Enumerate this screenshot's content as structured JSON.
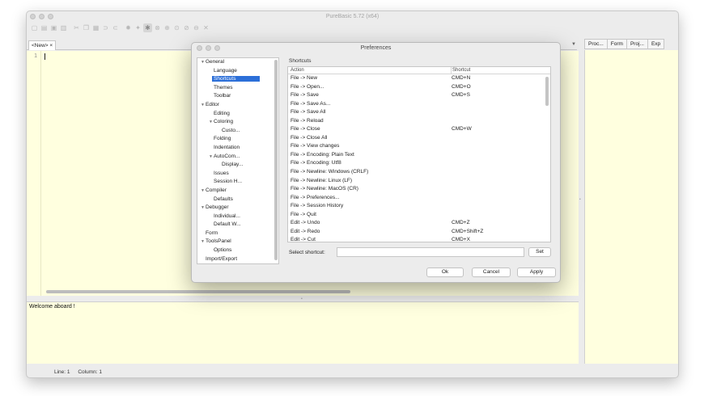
{
  "window": {
    "title": "PureBasic 5.72 (x64)"
  },
  "toolbar": {
    "icons": [
      "new-file-icon",
      "open-file-icon",
      "save-icon",
      "save-all-icon",
      "cut-icon",
      "copy-icon",
      "paste-icon",
      "comment-icon",
      "uncomment-icon",
      "compile-icon",
      "run-icon",
      "debugger-icon",
      "stop-icon",
      "step-icon",
      "step-over-icon",
      "step-out-icon",
      "kill-icon",
      "close-icon"
    ]
  },
  "editor": {
    "tab_label": "<New>",
    "tab_close": "×",
    "line_number": "1"
  },
  "output": {
    "text": "Welcome aboard !"
  },
  "status": {
    "line": "Line: 1",
    "column": "Column: 1"
  },
  "tool_tabs": [
    "Proc...",
    "Form",
    "Proj...",
    "Exp"
  ],
  "dialog": {
    "title": "Preferences",
    "tree": [
      {
        "label": "General",
        "level": 0,
        "expanded": true
      },
      {
        "label": "Language",
        "level": 1
      },
      {
        "label": "Shortcuts",
        "level": 1,
        "selected": true
      },
      {
        "label": "Themes",
        "level": 1
      },
      {
        "label": "Toolbar",
        "level": 1
      },
      {
        "label": "Editor",
        "level": 0,
        "expanded": true
      },
      {
        "label": "Editing",
        "level": 1
      },
      {
        "label": "Coloring",
        "level": 1,
        "expanded": true
      },
      {
        "label": "Custo...",
        "level": 2
      },
      {
        "label": "Folding",
        "level": 1
      },
      {
        "label": "Indentation",
        "level": 1
      },
      {
        "label": "AutoCom...",
        "level": 1,
        "expanded": true
      },
      {
        "label": "Display...",
        "level": 2
      },
      {
        "label": "Issues",
        "level": 1
      },
      {
        "label": "Session H...",
        "level": 1
      },
      {
        "label": "Compiler",
        "level": 0,
        "expanded": true
      },
      {
        "label": "Defaults",
        "level": 1
      },
      {
        "label": "Debugger",
        "level": 0,
        "expanded": true
      },
      {
        "label": "Individual...",
        "level": 1
      },
      {
        "label": "Default W...",
        "level": 1
      },
      {
        "label": "Form",
        "level": 0
      },
      {
        "label": "ToolsPanel",
        "level": 0,
        "expanded": true
      },
      {
        "label": "Options",
        "level": 1
      },
      {
        "label": "Import/Export",
        "level": 0
      }
    ],
    "shortcuts_title": "Shortcuts",
    "col_action": "Action",
    "col_shortcut": "Shortcut",
    "rows": [
      {
        "action": "File -> New",
        "shortcut": "CMD+N"
      },
      {
        "action": "File -> Open...",
        "shortcut": "CMD+O"
      },
      {
        "action": "File -> Save",
        "shortcut": "CMD+S"
      },
      {
        "action": "File -> Save As...",
        "shortcut": ""
      },
      {
        "action": "File -> Save All",
        "shortcut": ""
      },
      {
        "action": "File -> Reload",
        "shortcut": ""
      },
      {
        "action": "File -> Close",
        "shortcut": "CMD+W"
      },
      {
        "action": "File -> Close All",
        "shortcut": ""
      },
      {
        "action": "File -> View changes",
        "shortcut": ""
      },
      {
        "action": "File -> Encoding: Plain Text",
        "shortcut": ""
      },
      {
        "action": "File -> Encoding: Utf8",
        "shortcut": ""
      },
      {
        "action": "File -> Newline: Windows (CRLF)",
        "shortcut": ""
      },
      {
        "action": "File -> Newline: Linux (LF)",
        "shortcut": ""
      },
      {
        "action": "File -> Newline: MacOS (CR)",
        "shortcut": ""
      },
      {
        "action": "File -> Preferences...",
        "shortcut": ""
      },
      {
        "action": "File -> Session History",
        "shortcut": ""
      },
      {
        "action": "File -> Quit",
        "shortcut": ""
      },
      {
        "action": "Edit -> Undo",
        "shortcut": "CMD+Z"
      },
      {
        "action": "Edit -> Redo",
        "shortcut": "CMD+Shift+Z"
      },
      {
        "action": "Edit -> Cut",
        "shortcut": "CMD+X"
      }
    ],
    "select_label": "Select shortcut:",
    "select_value": "",
    "set_label": "Set",
    "ok_label": "Ok",
    "cancel_label": "Cancel",
    "apply_label": "Apply"
  },
  "colors": {
    "editor_bg": "#ffffdf",
    "selection": "#2c6fd8"
  }
}
